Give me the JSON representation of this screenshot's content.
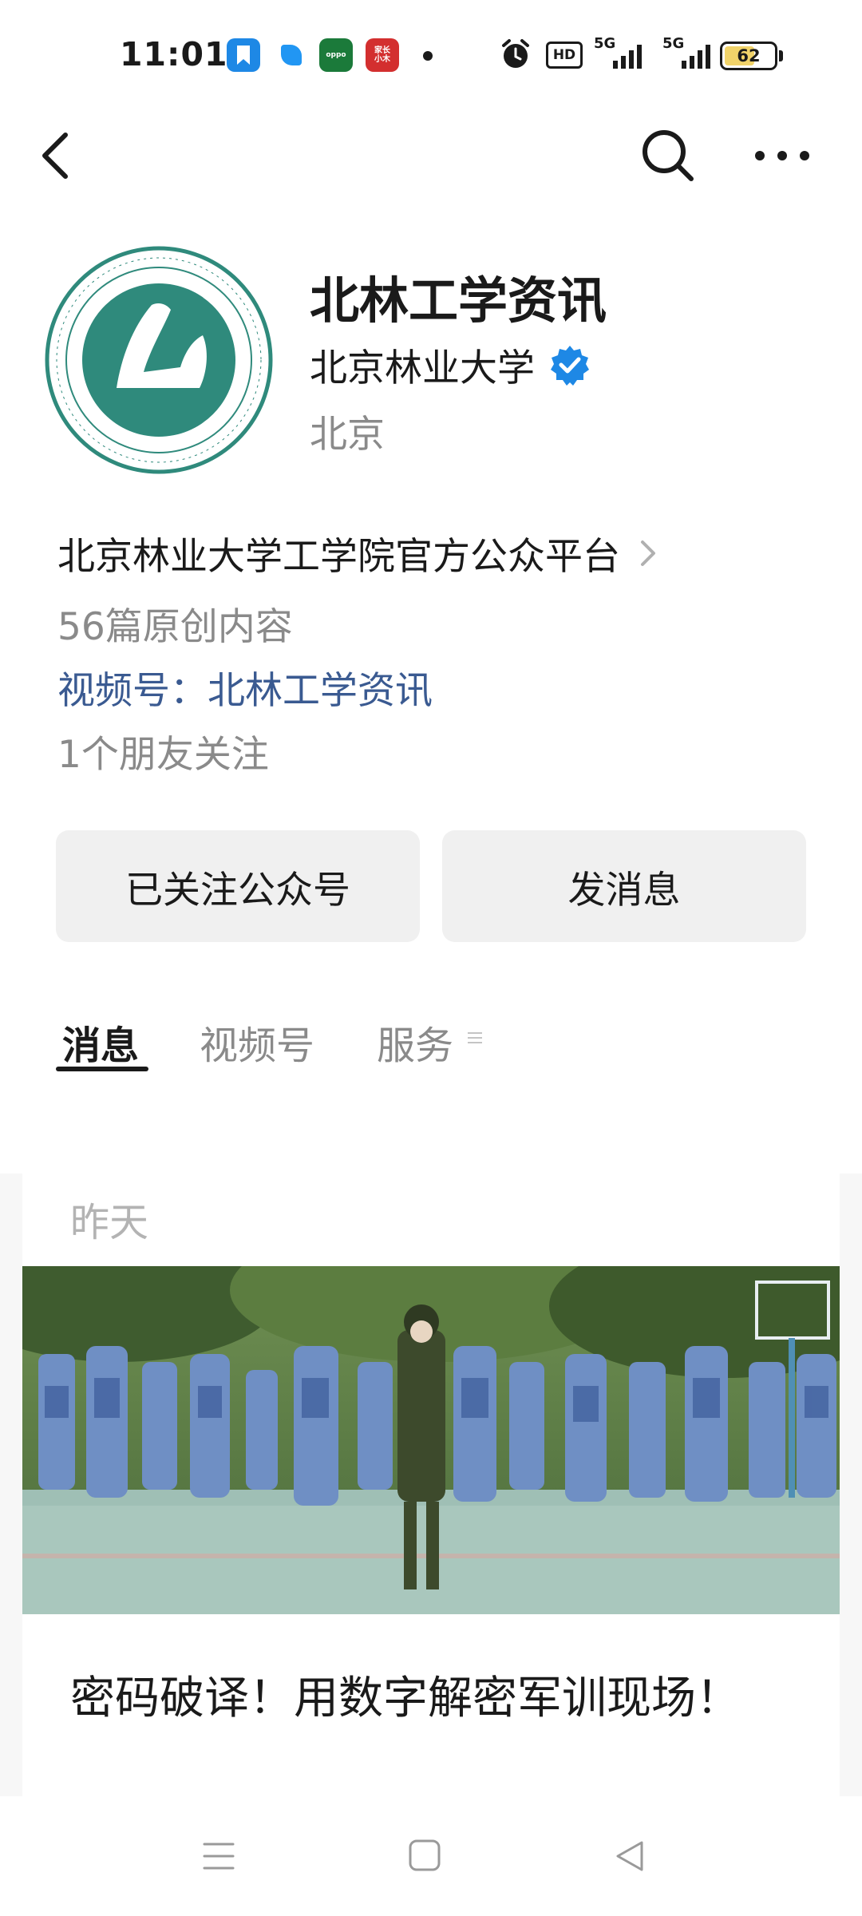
{
  "status_bar": {
    "time": "11:01",
    "app_icons": [
      "bookmark-app-icon",
      "feather-app-icon",
      "oppo-app-icon",
      "xiaohongshu-app-icon"
    ],
    "oppo_label": "oppo",
    "red_app_label": "家长\n小木",
    "hd_label": "HD",
    "signal_1_label": "5G",
    "signal_2_label": "5G",
    "battery_level": "62"
  },
  "profile": {
    "name": "北林工学资讯",
    "organization": "北京林业大学",
    "location": "北京",
    "description": "北京林业大学工学院官方公众平台",
    "original_count": "56篇原创内容",
    "channel": "视频号：北林工学资讯",
    "friends": "1个朋友关注"
  },
  "actions": {
    "follow_label": "已关注公众号",
    "message_label": "发消息"
  },
  "tabs": [
    {
      "label": "消息",
      "active": true
    },
    {
      "label": "视频号",
      "active": false
    },
    {
      "label": "服务",
      "active": false
    }
  ],
  "feed": {
    "date_group": "昨天",
    "articles": [
      {
        "title": "密码破译！用数字解密军训现场！"
      }
    ]
  },
  "colors": {
    "logo_teal": "#2f8a7c",
    "channel_link": "#3a5a91",
    "verified_blue": "#1e88e5",
    "battery_fill": "#f1d36a"
  }
}
